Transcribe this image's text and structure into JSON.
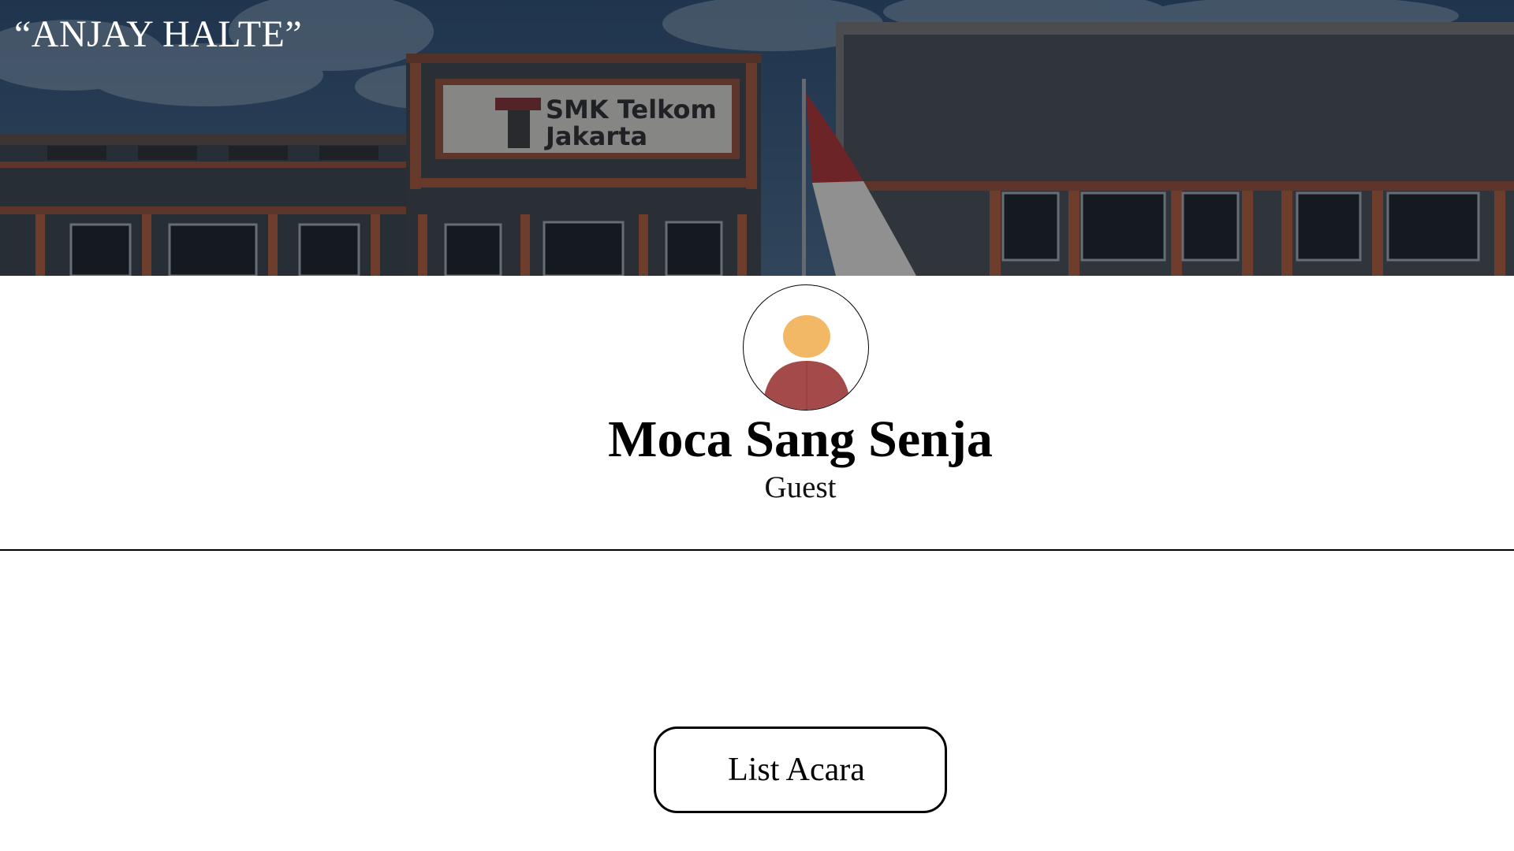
{
  "banner": {
    "title": "“ANJAY HALTE”",
    "sign_line1": "SMK Telkom",
    "sign_line2": "Jakarta"
  },
  "profile": {
    "name": "Moca Sang Senja",
    "role": "Guest"
  },
  "actions": {
    "list_button_label": "List Acara"
  },
  "colors": {
    "avatar_head": "#F2B866",
    "avatar_body": "#A54A4A",
    "accent_orange": "#C8623A"
  }
}
